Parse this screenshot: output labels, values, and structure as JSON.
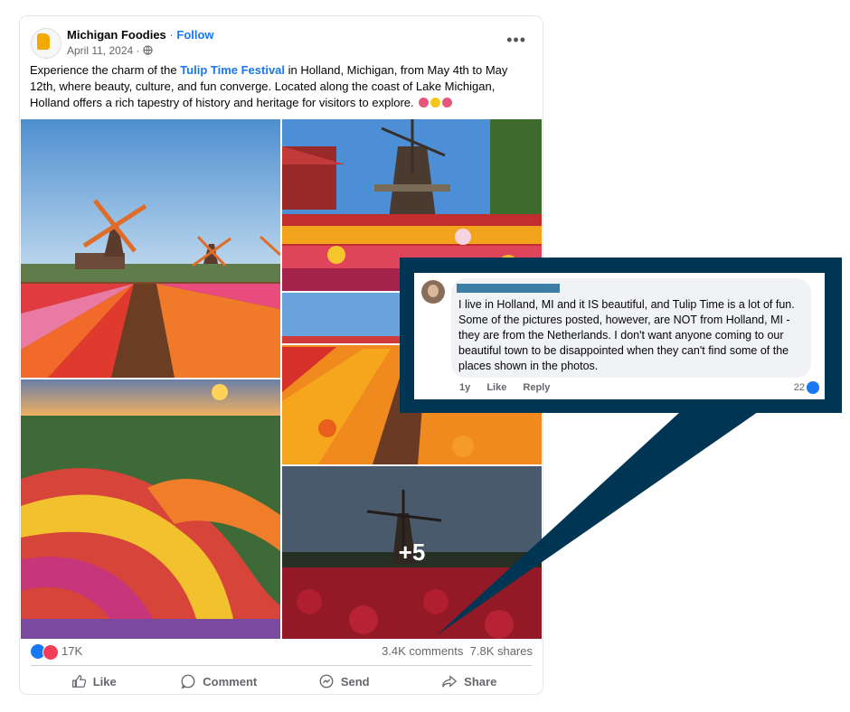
{
  "post": {
    "page_name": "Michigan Foodies",
    "separator": "·",
    "follow_label": "Follow",
    "date": "April 11, 2024 ·",
    "more_label": "•••",
    "text_part1": "Experience the charm of the ",
    "text_link": "Tulip Time Festival",
    "text_part2": " in Holland, Michigan, from May 4th to May 12th, where beauty, culture, and fun converge. Located along the coast of Lake Michigan, Holland offers a rich tapestry of history and heritage for visitors to explore.",
    "more_photos": "+5"
  },
  "stats": {
    "reactions": "17K",
    "comments_shares": "3.4K comments  7.8K shares"
  },
  "actions": {
    "like": "Like",
    "comment": "Comment",
    "send": "Send",
    "share": "Share"
  },
  "comment": {
    "text": "I live in Holland, MI and it IS beautiful, and Tulip Time is a lot of fun. Some of the pictures posted, however, are NOT from Holland, MI - they are from the Netherlands. I don't want anyone coming to our beautiful town to be disappointed when they can't find some of the places shown in the photos.",
    "age": "1y",
    "like": "Like",
    "reply": "Reply",
    "reaction_count": "22"
  },
  "colors": {
    "accent": "#1877f2",
    "callout": "#003654",
    "love": "#f33e58"
  }
}
